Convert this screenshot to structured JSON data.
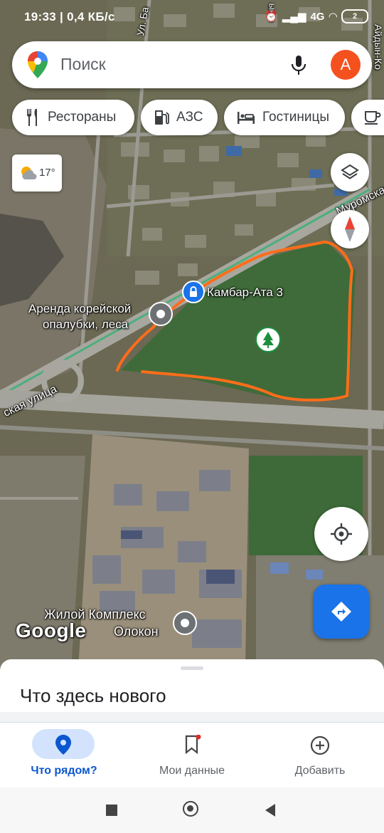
{
  "status_bar": {
    "time": "19:33",
    "speed": "0,4 КБ/с",
    "network": "4G",
    "battery": "2"
  },
  "search": {
    "placeholder": "Поиск",
    "avatar_letter": "А",
    "mic_icon": "mic-icon",
    "logo_icon": "google-maps-pin-icon"
  },
  "chips": [
    {
      "label": "Рестораны",
      "icon": "restaurant-icon"
    },
    {
      "label": "АЗС",
      "icon": "gas-station-icon"
    },
    {
      "label": "Гостиницы",
      "icon": "hotel-icon"
    },
    {
      "label": "",
      "icon": "coffee-icon"
    }
  ],
  "weather": {
    "temp": "17°",
    "icon": "partly-cloudy-icon"
  },
  "map": {
    "labels": {
      "street_1": "Муромская",
      "street_2": "ская улица",
      "street_3": "Ул. Ба",
      "street_4": "Айдын-Ко",
      "street_5": "ыны",
      "place_kambar": "Камбар-Ата 3",
      "place_arenda_1": "Аренда корейской",
      "place_arenda_2": "опалубки, леса",
      "place_zhk_1": "Жилой Комплекс",
      "place_zhk_2": "Олокон",
      "google_logo": "Google"
    },
    "colors": {
      "highlight_outline": "#ff6d1a",
      "route_line": "#4caf7d",
      "accent_blue": "#1a73e8"
    }
  },
  "sheet": {
    "title": "Что здесь нового"
  },
  "bottom_nav": [
    {
      "label": "Что рядом?",
      "icon": "explore-pin-icon",
      "active": true
    },
    {
      "label": "Мои данные",
      "icon": "bookmark-icon",
      "active": false
    },
    {
      "label": "Добавить",
      "icon": "add-circle-icon",
      "active": false
    }
  ]
}
